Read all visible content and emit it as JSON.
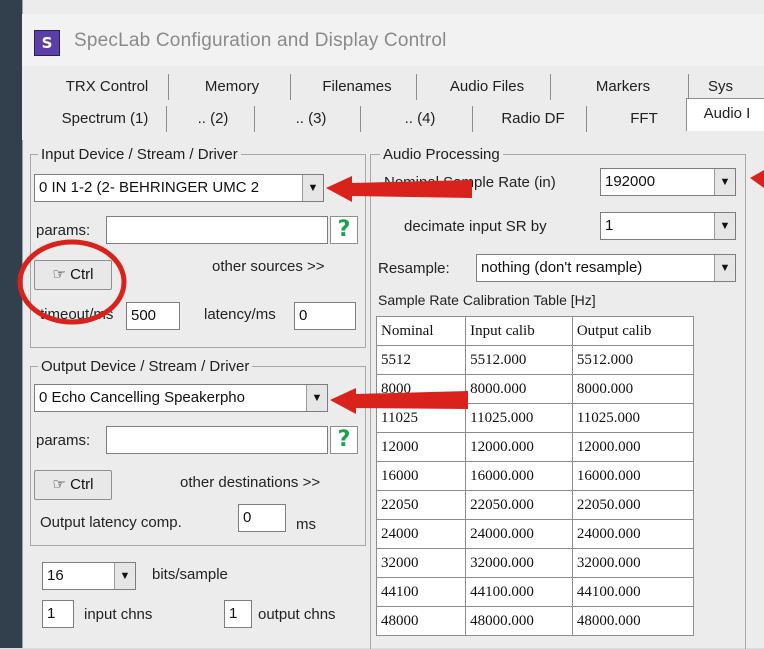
{
  "window": {
    "title": "SpecLab  Configuration and Display Control",
    "icon": "speclab-app-icon"
  },
  "tabs_row1": [
    "TRX Control",
    "Memory",
    "Filenames",
    "Audio Files",
    "Markers",
    "Sys"
  ],
  "tabs_row2": [
    "Spectrum (1)",
    ".. (2)",
    ".. (3)",
    ".. (4)",
    "Radio DF",
    "FFT",
    "Audio I"
  ],
  "input_group": {
    "title": "Input Device / Stream / Driver",
    "device": "0 IN 1-2 (2- BEHRINGER UMC 2",
    "params_label": "params:",
    "params_value": "",
    "ctrl_label": "Ctrl",
    "other_sources_label": "other sources >>",
    "timeout_label": "timeout/ms",
    "timeout_value": "500",
    "latency_label": "latency/ms",
    "latency_value": "0"
  },
  "output_group": {
    "title": "Output Device / Stream / Driver",
    "device": "0 Echo Cancelling Speakerpho",
    "params_label": "params:",
    "params_value": "",
    "ctrl_label": "Ctrl",
    "other_destinations_label": "other destinations >>",
    "latency_label": "Output latency comp.",
    "latency_value": "0",
    "latency_unit": "ms"
  },
  "bits": {
    "value": "16",
    "label": "bits/sample"
  },
  "channels": {
    "input_value": "1",
    "input_label": "input chns",
    "output_value": "1",
    "output_label": "output chns"
  },
  "audio_processing": {
    "title": "Audio Processing",
    "nominal_label": "Nominal Sample Rate (in)",
    "nominal_value": "192000",
    "decimate_label": "decimate input SR by",
    "decimate_value": "1",
    "resample_label": "Resample:",
    "resample_value": "nothing (don't resample)",
    "cal_table_label": "Sample Rate Calibration Table [Hz]",
    "cal_headers": [
      "Nominal",
      "Input calib",
      "Output calib"
    ],
    "cal_rows": [
      [
        "5512",
        "5512.000",
        "5512.000"
      ],
      [
        "8000",
        "8000.000",
        "8000.000"
      ],
      [
        "11025",
        "11025.000",
        "11025.000"
      ],
      [
        "12000",
        "12000.000",
        "12000.000"
      ],
      [
        "16000",
        "16000.000",
        "16000.000"
      ],
      [
        "22050",
        "22050.000",
        "22050.000"
      ],
      [
        "24000",
        "24000.000",
        "24000.000"
      ],
      [
        "32000",
        "32000.000",
        "32000.000"
      ],
      [
        "44100",
        "44100.000",
        "44100.000"
      ],
      [
        "48000",
        "48000.000",
        "48000.000"
      ]
    ]
  },
  "colors": {
    "annotation_red": "#d9221c",
    "help_green": "#1aa34a"
  }
}
